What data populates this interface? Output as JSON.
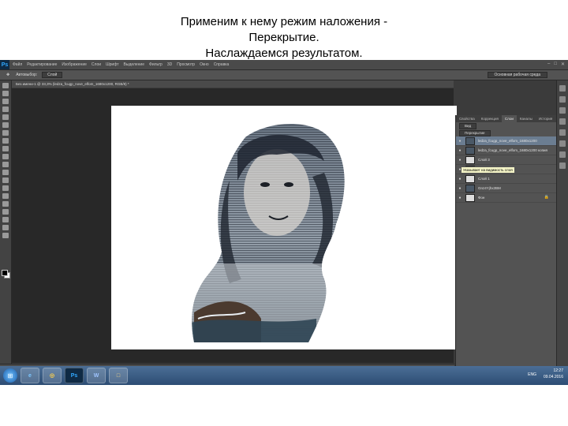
{
  "caption": {
    "line1": "Применим к нему режим наложения -",
    "line2": "Перекрытие.",
    "line3": "Наслаждаемся результатом."
  },
  "app": {
    "logo": "Ps",
    "menu": [
      "Файл",
      "Редактирование",
      "Изображение",
      "Слои",
      "Шрифт",
      "Выделение",
      "Фильтр",
      "3D",
      "Просмотр",
      "Окно",
      "Справка"
    ],
    "window_controls": [
      "–",
      "□",
      "✕"
    ]
  },
  "options": {
    "autoselect": "Автовыбор:",
    "autoselect_value": "Слой",
    "workspace": "Основная рабочая среда"
  },
  "document": {
    "tab_label": "Без имени-1 @ 33,3% (ledza_fcugp_nove_elfom_1680x1200, RGB/8) *"
  },
  "status": {
    "zoom": "50,22%",
    "doc_size": "Док: 14,9М/28,4М"
  },
  "panel": {
    "tabs": [
      "Свойства",
      "Коррекция",
      "Слои",
      "Каналы",
      "История"
    ],
    "active_tab": "Слои",
    "kind": "Вид",
    "blend_mode": "Перекрытие",
    "layers": [
      {
        "name": "ledza_fcugp_nove_elfom_1680x1200",
        "selected": true
      },
      {
        "name": "ledza_fcugp_nove_elfom_1680x1200 копия",
        "selected": false
      },
      {
        "name": "Слой 3",
        "selected": false
      },
      {
        "name": "Слой 2",
        "selected": false
      },
      {
        "name": "Слой 1",
        "selected": false
      },
      {
        "name": "Gnz4Yjhx2BM",
        "selected": false
      },
      {
        "name": "Фон",
        "selected": false,
        "locked": true
      }
    ],
    "tooltip": "Указывает на видимость слоя"
  },
  "taskbar": {
    "apps": [
      "e",
      "◎",
      "Ps",
      "W",
      "□"
    ],
    "lang": "ENG",
    "time": "12:27",
    "date": "09.04.2016"
  },
  "colors": {
    "ps_dark": "#3b3b3b",
    "selected_layer": "#6b7d91",
    "taskbar": "#2d4d74"
  }
}
